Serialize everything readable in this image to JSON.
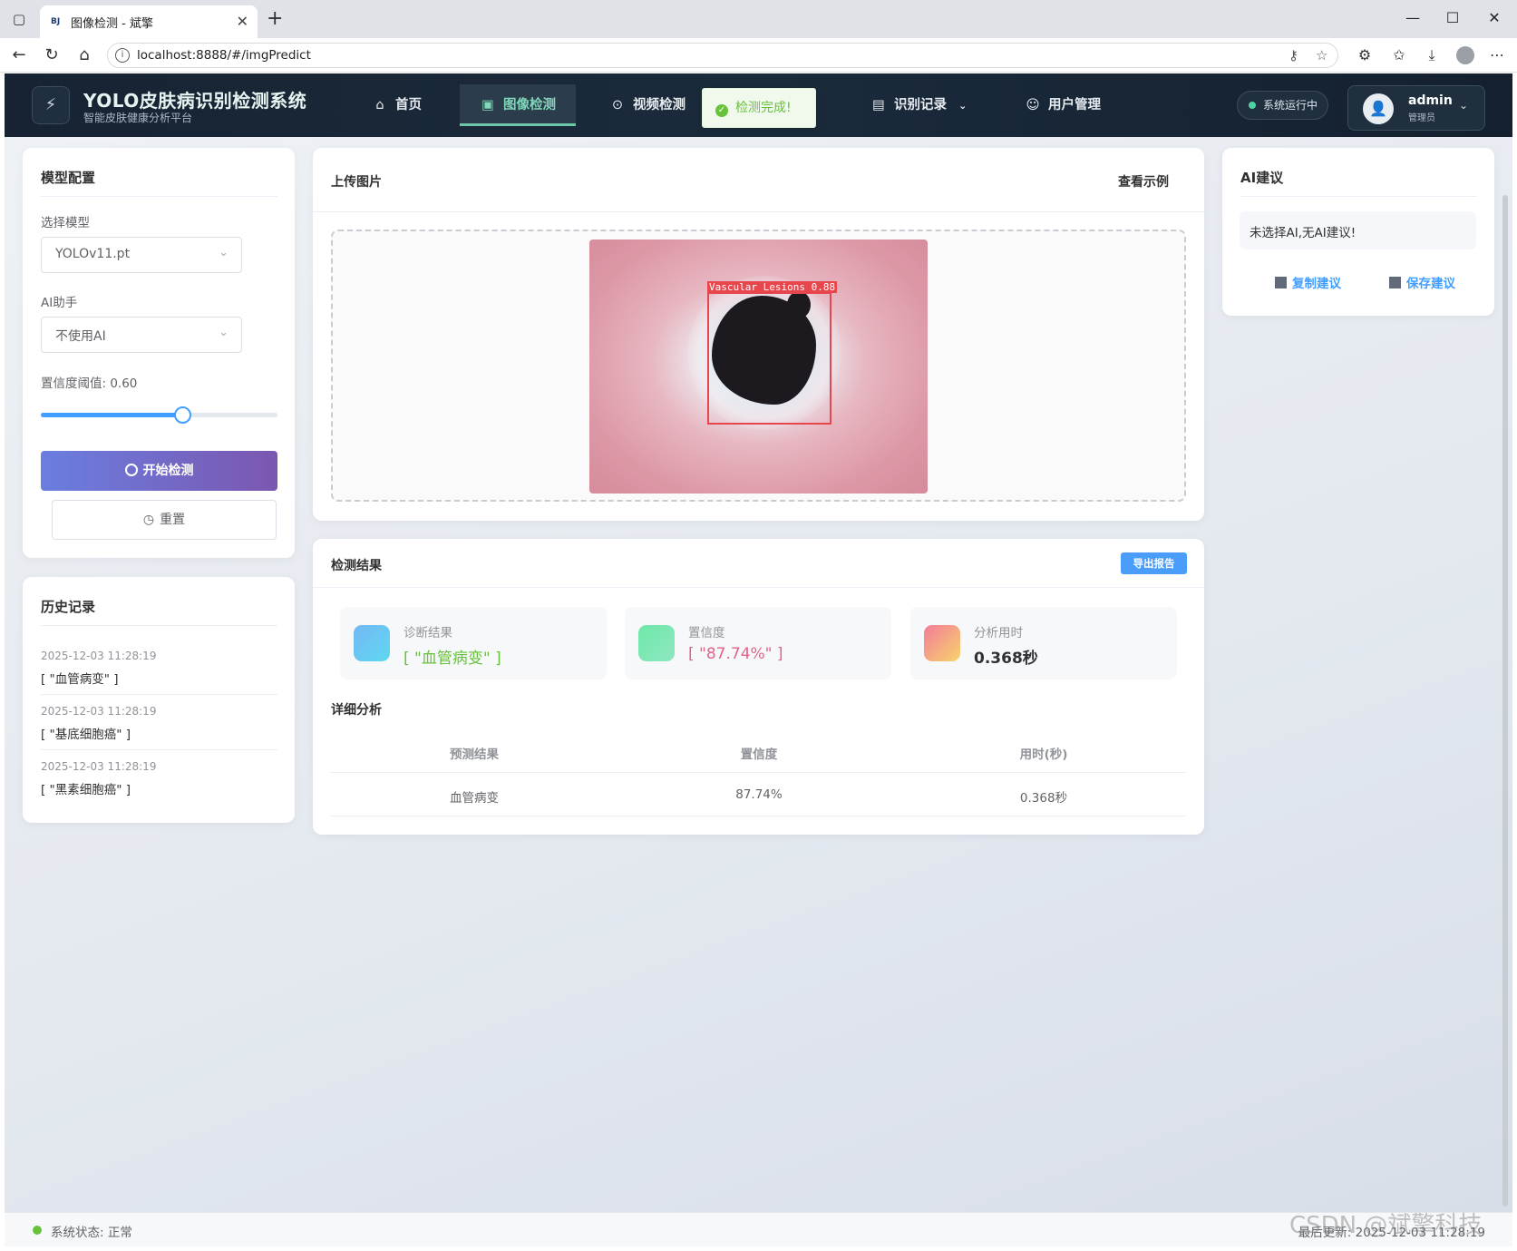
{
  "browser": {
    "tab_title": "图像检测 - 斌擎",
    "tab_favicon": "BJ",
    "url": "localhost:8888/#/imgPredict"
  },
  "header": {
    "title": "YOLO皮肤病识别检测系统",
    "subtitle": "智能皮肤健康分析平台",
    "nav": [
      {
        "label": "首页",
        "icon": "home-icon"
      },
      {
        "label": "图像检测",
        "icon": "image-icon",
        "active": true
      },
      {
        "label": "视频检测",
        "icon": "play-circle-icon"
      },
      {
        "label": "识别记录",
        "icon": "document-icon"
      },
      {
        "label": "用户管理",
        "icon": "user-icon"
      }
    ],
    "status_label": "系统运行中",
    "user": {
      "name": "admin",
      "role": "管理员"
    }
  },
  "toast": {
    "message": "检测完成!",
    "color": "#67c23a"
  },
  "config": {
    "title": "模型配置",
    "model_label": "选择模型",
    "model_value": "YOLOv11.pt",
    "ai_label": "AI助手",
    "ai_value": "不使用AI",
    "confidence_label": "置信度阈值: 0.60",
    "confidence_value": 0.6,
    "start_label": "开始检测",
    "reset_label": "重置"
  },
  "history": {
    "title": "历史记录",
    "items": [
      {
        "time": "2025-12-03 11:28:19",
        "value": "[ \"血管病变\" ]"
      },
      {
        "time": "2025-12-03 11:28:19",
        "value": "[ \"基底细胞癌\" ]"
      },
      {
        "time": "2025-12-03 11:28:19",
        "value": "[ \"黑素细胞癌\" ]"
      }
    ]
  },
  "upload": {
    "title": "上传图片",
    "example_label": "查看示例",
    "detection_label": "Vascular Lesions 0.88"
  },
  "results": {
    "title": "检测结果",
    "export_label": "导出报告",
    "cards": [
      {
        "label": "诊断结果",
        "value": "[ \"血管病变\" ]",
        "color": "#67c23a"
      },
      {
        "label": "置信度",
        "value": "[ \"87.74%\" ]",
        "color": "#e5608a"
      },
      {
        "label": "分析用时",
        "value": "0.368秒",
        "color": "#303133"
      }
    ],
    "detail_title": "详细分析",
    "table": {
      "headers": [
        "预测结果",
        "置信度",
        "用时(秒)"
      ],
      "rows": [
        [
          "血管病变",
          "87.74%",
          "0.368秒"
        ]
      ]
    }
  },
  "ai": {
    "title": "AI建议",
    "message": "未选择AI,无AI建议!",
    "copy_label": "复制建议",
    "save_label": "保存建议"
  },
  "footer": {
    "status": "系统状态: 正常",
    "updated": "最后更新: 2025-12-03 11:28:19"
  },
  "watermark": "CSDN @斌擎科技"
}
